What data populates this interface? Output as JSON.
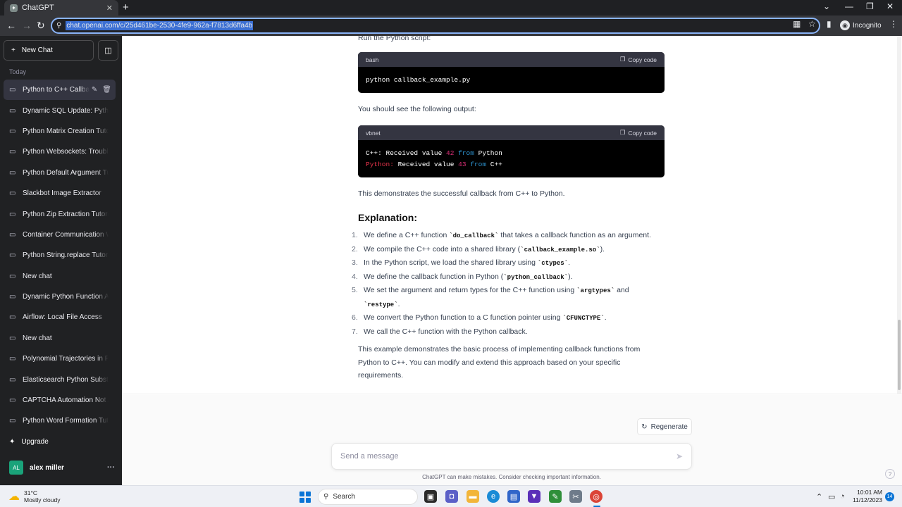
{
  "browser": {
    "tab_title": "ChatGPT",
    "url": "chat.openai.com/c/25d461be-2530-4fe9-962a-f7813d6ffa4b",
    "profile_label": "Incognito"
  },
  "sidebar": {
    "new_chat_label": "New Chat",
    "section_label": "Today",
    "items": [
      {
        "label": "Python to C++ Callback",
        "active": true
      },
      {
        "label": "Dynamic SQL Update: Python"
      },
      {
        "label": "Python Matrix Creation Tutorial"
      },
      {
        "label": "Python Websockets: Troubleshoot"
      },
      {
        "label": "Python Default Argument Tutorial"
      },
      {
        "label": "Slackbot Image Extractor"
      },
      {
        "label": "Python Zip Extraction Tutorial"
      },
      {
        "label": "Container Communication W"
      },
      {
        "label": "Python String.replace Tutorial"
      },
      {
        "label": "New chat"
      },
      {
        "label": "Dynamic Python Function A"
      },
      {
        "label": "Airflow: Local File Access"
      },
      {
        "label": "New chat"
      },
      {
        "label": "Polynomial Trajectories in Py"
      },
      {
        "label": "Elasticsearch Python Substri"
      },
      {
        "label": "CAPTCHA Automation Not A"
      },
      {
        "label": "Python Word Formation Tuto"
      }
    ],
    "upgrade_label": "Upgrade",
    "user_initials": "AL",
    "user_name": "alex miller"
  },
  "conversation": {
    "top_text": "Run the Python script:",
    "code1": {
      "lang": "bash",
      "copy_label": "Copy code",
      "line": "python callback_example.py"
    },
    "output_intro": "You should see the following output:",
    "code2": {
      "lang": "vbnet",
      "copy_label": "Copy code",
      "line1": {
        "a": "C++: Received value ",
        "num": "42",
        "sp": " ",
        "kw": "from",
        "b": " Python"
      },
      "line2": {
        "a": "Python:",
        "b": " Received value ",
        "num": "43",
        "sp": " ",
        "kw": "from",
        "c": " C++"
      }
    },
    "demo_text": "This demonstrates the successful callback from C++ to Python.",
    "explanation_heading": "Explanation:",
    "steps": [
      {
        "n": "1.",
        "pre": "We define a C++ function ",
        "code": "`do_callback`",
        "post": " that takes a callback function as an argument."
      },
      {
        "n": "2.",
        "pre": "We compile the C++ code into a shared library (",
        "code": "`callback_example.so`",
        "post": ")."
      },
      {
        "n": "3.",
        "pre": "In the Python script, we load the shared library using ",
        "code": "`ctypes`",
        "post": "."
      },
      {
        "n": "4.",
        "pre": "We define the callback function in Python (",
        "code": "`python_callback`",
        "post": ")."
      },
      {
        "n": "5.",
        "pre": "We set the argument and return types for the C++ function using ",
        "code": "`argtypes`",
        "post": " and",
        "code2": "`restype`",
        "post2": "."
      },
      {
        "n": "6.",
        "pre": "We convert the Python function to a C function pointer using ",
        "code": "`CFUNCTYPE`",
        "post": "."
      },
      {
        "n": "7.",
        "pre": "We call the C++ function with the Python callback.",
        "code": "",
        "post": ""
      }
    ],
    "closing_text": "This example demonstrates the basic process of implementing callback functions from Python to C++. You can modify and extend this approach based on your specific requirements."
  },
  "composer": {
    "regenerate_label": "Regenerate",
    "placeholder": "Send a message",
    "disclaimer": "ChatGPT can make mistakes. Consider checking important information.",
    "help_label": "?"
  },
  "taskbar": {
    "weather_temp": "31°C",
    "weather_desc": "Mostly cloudy",
    "search_label": "Search",
    "time": "10:01 AM",
    "date": "11/12/2023",
    "notif_count": "14"
  },
  "colors": {
    "sidebar_bg": "#202123",
    "code_bg": "#000000",
    "accent_green": "#1aa37a",
    "start_blue": "#0a74d6"
  }
}
